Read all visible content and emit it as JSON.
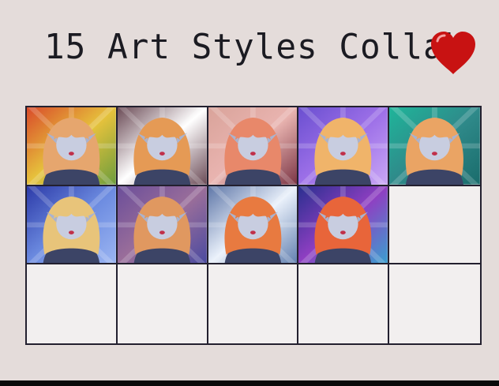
{
  "title": "15 Art Styles Collab",
  "grid": {
    "columns": 5,
    "rows": 3,
    "cells": [
      {
        "bg": [
          "#d94a2a",
          "#e6c23c",
          "#6c9d3d"
        ],
        "hair": "#e6a66e"
      },
      {
        "bg": [
          "#6b4b56",
          "#ffffff",
          "#6b4b56"
        ],
        "hair": "#e59a55"
      },
      {
        "bg": [
          "#d9a39a",
          "#e9b4b0",
          "#7a3444"
        ],
        "hair": "#e8886a"
      },
      {
        "bg": [
          "#6a4fd0",
          "#9d70e8",
          "#c9a6f5"
        ],
        "hair": "#f0b46a"
      },
      {
        "bg": [
          "#1fb59a",
          "#2f8a8a",
          "#1a6c6c"
        ],
        "hair": "#eaa464"
      },
      {
        "bg": [
          "#2c3aa8",
          "#6c8be0",
          "#9bb5f2"
        ],
        "hair": "#e8c47a"
      },
      {
        "bg": [
          "#6b4e9a",
          "#9a6e9a",
          "#4a4aa0"
        ],
        "hair": "#e09860"
      },
      {
        "bg": [
          "#5f77a8",
          "#e9f0fa",
          "#6280b0"
        ],
        "hair": "#e87a40"
      },
      {
        "bg": [
          "#2a2f8f",
          "#8f3fc2",
          "#3aa0d0"
        ],
        "hair": "#e8653a"
      },
      null,
      null,
      null,
      null,
      null,
      null
    ]
  }
}
